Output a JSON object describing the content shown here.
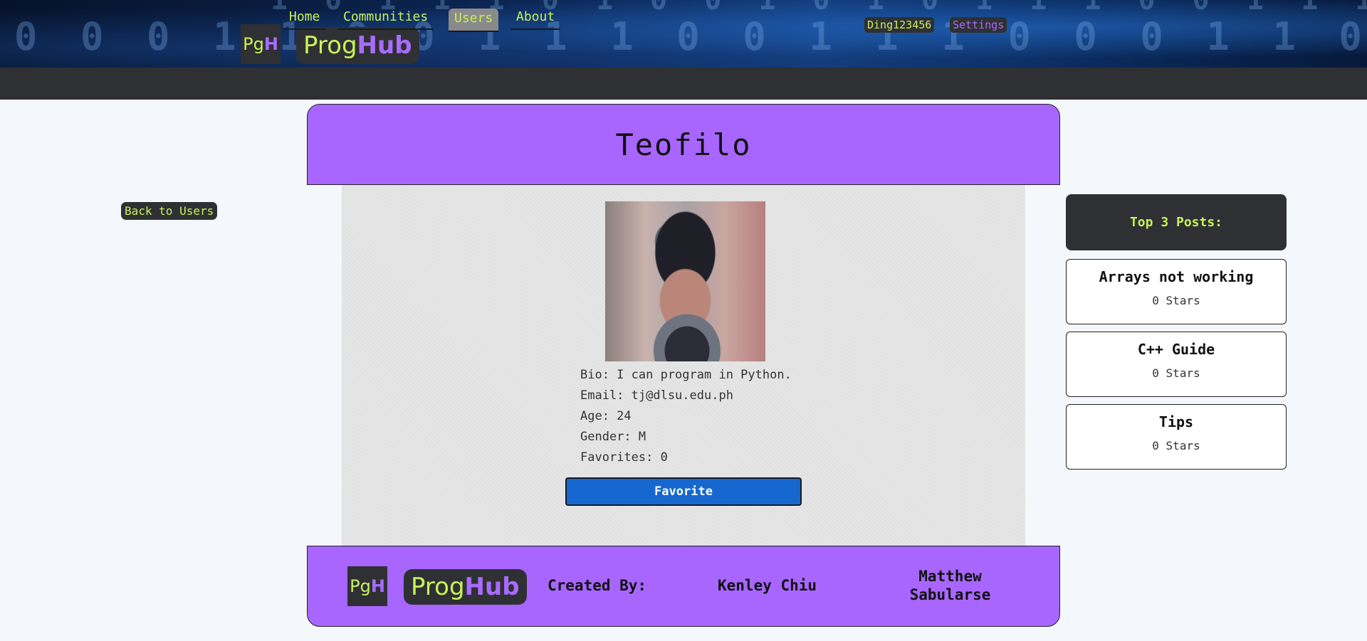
{
  "header": {
    "logo_mark_pg": "Pg",
    "logo_mark_h": "H",
    "logo_prog": "Prog",
    "logo_hub": "Hub",
    "username": "Ding123456",
    "settings_label": "Settings"
  },
  "nav": {
    "items": [
      {
        "label": "Home"
      },
      {
        "label": "Communities"
      },
      {
        "label": "Users",
        "active": true
      },
      {
        "label": "About"
      }
    ]
  },
  "profile": {
    "name": "Teofilo",
    "back_label": "Back to Users",
    "bio": "Bio: I can program in Python.",
    "email": "Email: tj@dlsu.edu.ph",
    "age": "Age: 24",
    "gender": "Gender: M",
    "favorites": "Favorites: 0",
    "favorite_button": "Favorite"
  },
  "sidebar": {
    "heading": "Top 3 Posts:",
    "posts": [
      {
        "title": "Arrays not working",
        "stars": "0 Stars"
      },
      {
        "title": "C++ Guide",
        "stars": "0 Stars"
      },
      {
        "title": "Tips",
        "stars": "0 Stars"
      }
    ]
  },
  "footer": {
    "created_by": "Created By:",
    "author1": "Kenley Chiu",
    "author2_line1": "Matthew",
    "author2_line2": "Sabularse"
  },
  "colors": {
    "accent_green": "#c7f25a",
    "accent_purple": "#a866ff",
    "dark": "#2f3033",
    "button_blue": "#1668d0"
  }
}
